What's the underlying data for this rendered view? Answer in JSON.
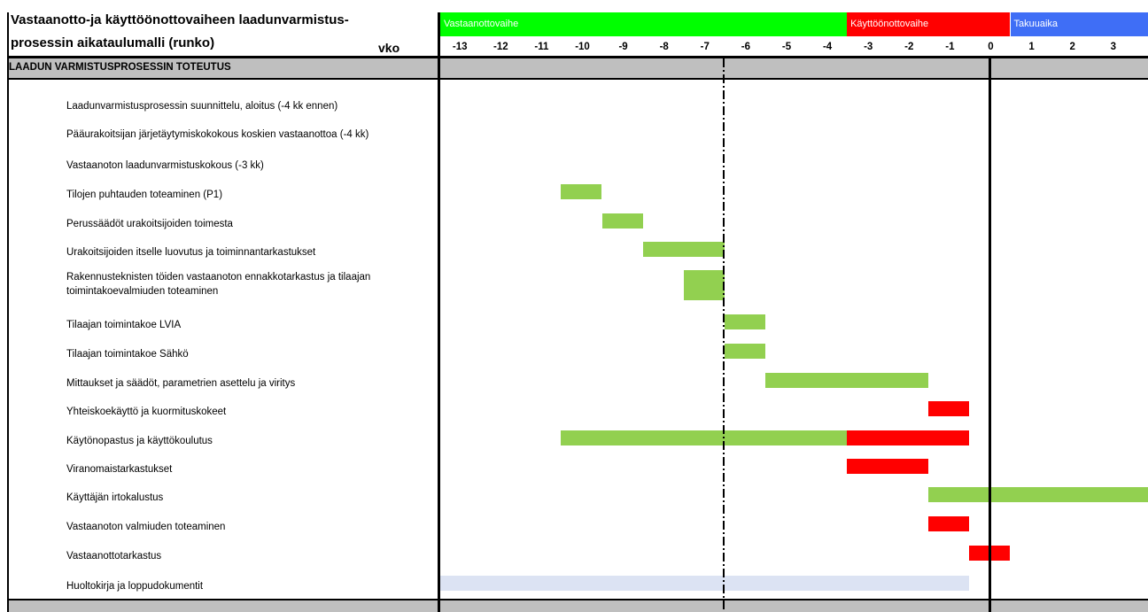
{
  "title": {
    "line1": "Vastaanotto-ja käyttöönottovaiheen laadunvarmistus-",
    "line2": "prosessin aikataulumalli (runko)",
    "week_label": "vko"
  },
  "phases": [
    {
      "name": "Vastaanottovaihe",
      "color": "#00ff00",
      "start": -14,
      "end": -4
    },
    {
      "name": "Käyttöönottovaihe",
      "color": "#ff0000",
      "start": -4,
      "end": 0
    },
    {
      "name": "Takuuaika",
      "color": "#3f6ef6",
      "start": 0,
      "end": 3.4
    }
  ],
  "section_label": "LAADUN VARMISTUSPROSESSIN TOTEUTUS",
  "colors": {
    "green": "#92d050",
    "red": "#ff0000",
    "lightblue": "#dce3f3",
    "band": "#bfbfbf"
  },
  "chart_data": {
    "type": "gantt",
    "x_unit": "vko",
    "x_ticks": [
      "-13",
      "-12",
      "-11",
      "-10",
      "-9",
      "-8",
      "-7",
      "-6",
      "-5",
      "-4",
      "-3",
      "-2",
      "-1",
      "0",
      "1",
      "2",
      "3"
    ],
    "xlim": [
      -14,
      3.4
    ],
    "reference_lines": {
      "dashdot_week": -7,
      "solid_week": -1
    },
    "tasks": [
      {
        "label": "Laadunvarmistusprosessin suunnittelu, aloitus (-4 kk ennen)",
        "bars": []
      },
      {
        "label": "Pääurakoitsijan järjetäytymiskokokous koskien vastaanottoa (-4 kk)",
        "bars": []
      },
      {
        "label": "Vastaanoton laadunvarmistuskokous (-3 kk)",
        "bars": []
      },
      {
        "label": "Tilojen puhtauden toteaminen (P1)",
        "bars": [
          {
            "start": -11,
            "end": -10,
            "color": "green"
          }
        ]
      },
      {
        "label": "Perussäädöt urakoitsijoiden toimesta",
        "bars": [
          {
            "start": -10,
            "end": -9,
            "color": "green"
          }
        ]
      },
      {
        "label": "Urakoitsijoiden itselle luovutus ja toiminnantarkastukset",
        "bars": [
          {
            "start": -9,
            "end": -7,
            "color": "green"
          }
        ]
      },
      {
        "label": "Rakennusteknisten töiden vastaanoton ennakkotarkastus ja tilaajan toimintakoevalmiuden toteaminen",
        "bars": [
          {
            "start": -8,
            "end": -7,
            "color": "green"
          }
        ]
      },
      {
        "label": "Tilaajan toimintakoe LVIA",
        "bars": [
          {
            "start": -7,
            "end": -6,
            "color": "green"
          }
        ]
      },
      {
        "label": "Tilaajan toimintakoe Sähkö",
        "bars": [
          {
            "start": -7,
            "end": -6,
            "color": "green"
          }
        ]
      },
      {
        "label": "Mittaukset ja säädöt, parametrien asettelu ja viritys",
        "bars": [
          {
            "start": -6,
            "end": -2,
            "color": "green"
          }
        ]
      },
      {
        "label": "Yhteiskoekäyttö ja kuormituskokeet",
        "bars": [
          {
            "start": -2,
            "end": -1,
            "color": "red"
          }
        ]
      },
      {
        "label": "Käytönopastus ja käyttökoulutus",
        "bars": [
          {
            "start": -11,
            "end": -4,
            "color": "green"
          },
          {
            "start": -4,
            "end": -1,
            "color": "red"
          }
        ]
      },
      {
        "label": "Viranomaistarkastukset",
        "bars": [
          {
            "start": -4,
            "end": -2,
            "color": "red"
          }
        ]
      },
      {
        "label": "Käyttäjän irtokalustus",
        "bars": [
          {
            "start": -2,
            "end": 3.4,
            "color": "green"
          }
        ]
      },
      {
        "label": "Vastaanoton valmiuden toteaminen",
        "bars": [
          {
            "start": -2,
            "end": -1,
            "color": "red"
          }
        ]
      },
      {
        "label": "Vastaanottotarkastus",
        "bars": [
          {
            "start": -1,
            "end": 0,
            "color": "red"
          }
        ]
      },
      {
        "label": "Huoltokirja ja loppudokumentit",
        "bars": [
          {
            "start": -14,
            "end": -1,
            "color": "lightblue"
          }
        ]
      }
    ]
  }
}
